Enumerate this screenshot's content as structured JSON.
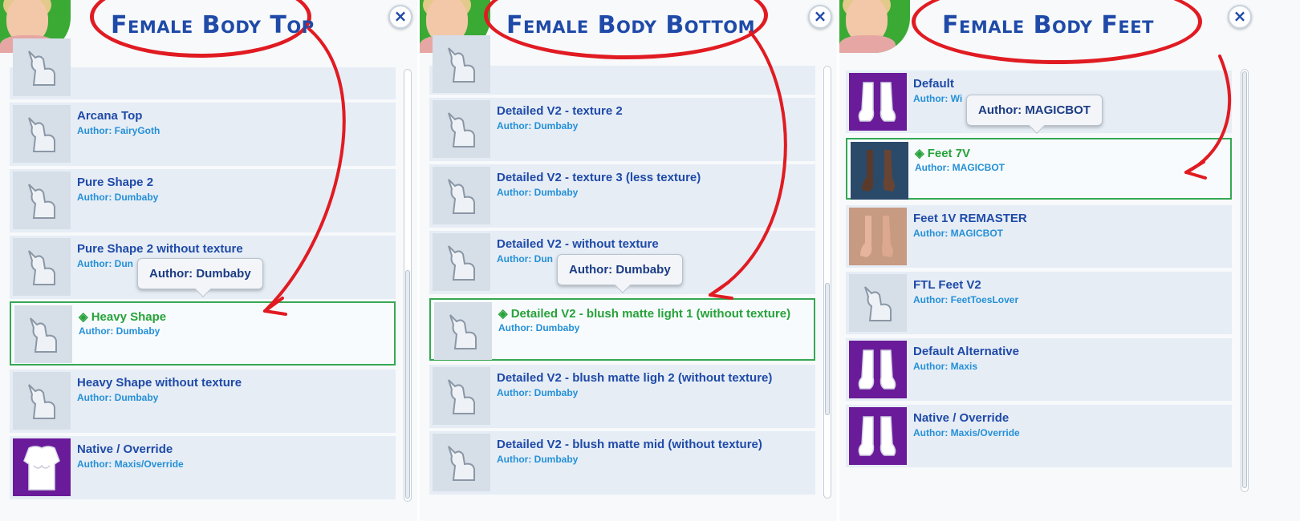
{
  "colors": {
    "title": "#1f4aa8",
    "annotation": "#e11b22",
    "selected_outline": "#34a853",
    "author_text": "#2490d8",
    "row_bg": "#e6edf5"
  },
  "panels": [
    {
      "title": "Female Body Top",
      "close_icon": "×",
      "tooltip": "Author: Dumbaby",
      "items": [
        {
          "name": "",
          "author": "",
          "thumb": "llama-icon"
        },
        {
          "name": "Arcana Top",
          "author": "Author: FairyGoth",
          "thumb": "llama-icon"
        },
        {
          "name": "Pure Shape 2",
          "author": "Author: Dumbaby",
          "thumb": "llama-icon"
        },
        {
          "name": "Pure Shape 2 without texture",
          "author": "Author: Dun",
          "thumb": "llama-icon"
        },
        {
          "name": "◈ Heavy Shape",
          "author": "Author: Dumbaby",
          "thumb": "llama-icon",
          "selected": true
        },
        {
          "name": "Heavy Shape without texture",
          "author": "Author: Dumbaby",
          "thumb": "llama-icon"
        },
        {
          "name": "Native / Override",
          "author": "Author: Maxis/Override",
          "thumb": "torso-icon"
        }
      ]
    },
    {
      "title": "Female Body Bottom",
      "close_icon": "×",
      "tooltip": "Author: Dumbaby",
      "items": [
        {
          "name": "",
          "author": "",
          "thumb": "llama-icon"
        },
        {
          "name": "Detailed V2 - texture 2",
          "author": "Author: Dumbaby",
          "thumb": "llama-icon"
        },
        {
          "name": "Detailed V2 - texture 3 (less texture)",
          "author": "Author: Dumbaby",
          "thumb": "llama-icon"
        },
        {
          "name": "Detailed V2 - without texture",
          "author": "Author: Dun",
          "thumb": "llama-icon"
        },
        {
          "name": "◈ Detailed V2 - blush matte light 1 (without texture)",
          "author": "Author: Dumbaby",
          "thumb": "llama-icon",
          "selected": true
        },
        {
          "name": "Detailed V2 - blush matte ligh 2 (without texture)",
          "author": "Author: Dumbaby",
          "thumb": "llama-icon"
        },
        {
          "name": "Detailed V2 - blush matte mid (without texture)",
          "author": "Author: Dumbaby",
          "thumb": "llama-icon"
        }
      ]
    },
    {
      "title": "Female Body Feet",
      "close_icon": "×",
      "tooltip": "Author: MAGICBOT",
      "items": [
        {
          "name": "Default",
          "author": "Author: Wi",
          "thumb": "feet-icon"
        },
        {
          "name": "◈ Feet 7V",
          "author": "Author: MAGICBOT",
          "thumb": "feet-photo-dark",
          "selected": true
        },
        {
          "name": "Feet 1V REMASTER",
          "author": "Author: MAGICBOT",
          "thumb": "feet-photo"
        },
        {
          "name": "FTL Feet V2",
          "author": "Author: FeetToesLover",
          "thumb": "llama-icon"
        },
        {
          "name": "Default Alternative",
          "author": "Author: Maxis",
          "thumb": "feet-icon"
        },
        {
          "name": "Native / Override",
          "author": "Author: Maxis/Override",
          "thumb": "feet-icon"
        }
      ]
    }
  ]
}
